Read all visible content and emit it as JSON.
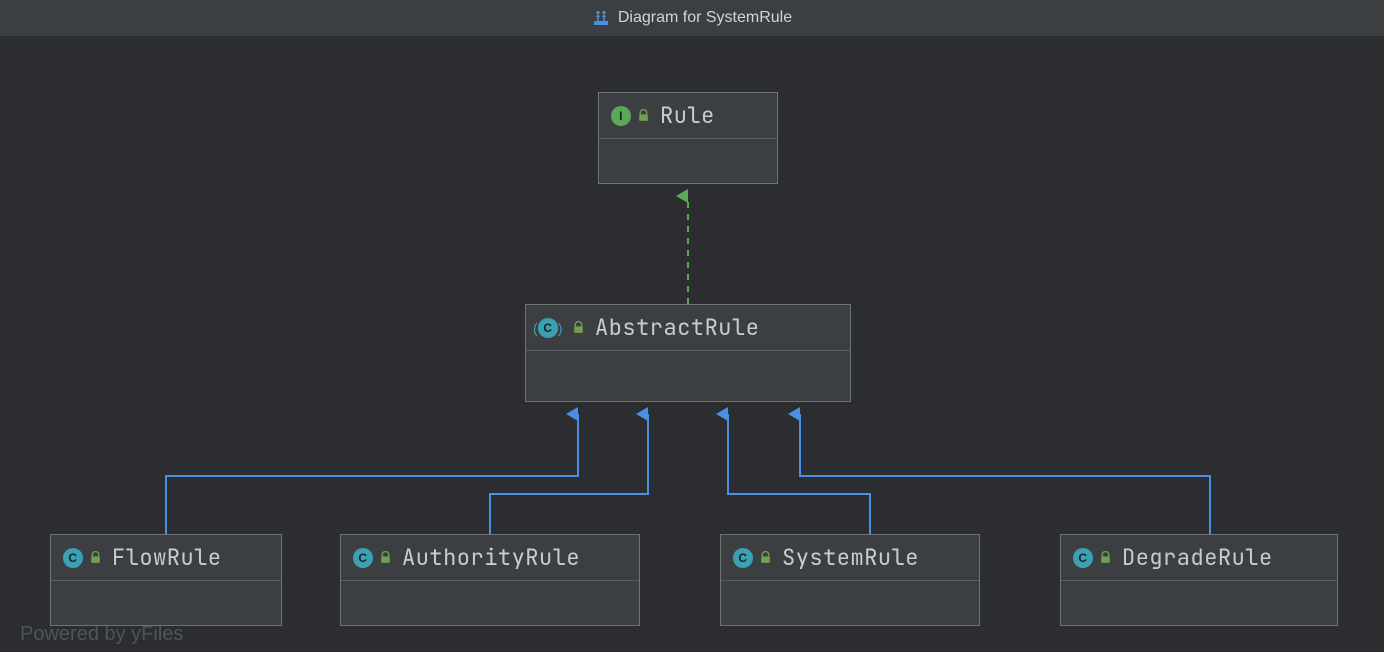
{
  "header": {
    "title": "Diagram for SystemRule"
  },
  "nodes": {
    "rule": {
      "name": "Rule",
      "kind": "interface",
      "badge_letter": "I"
    },
    "abstractRule": {
      "name": "AbstractRule",
      "kind": "abstract-class",
      "badge_letter": "C"
    },
    "flowRule": {
      "name": "FlowRule",
      "kind": "class",
      "badge_letter": "C"
    },
    "authorityRule": {
      "name": "AuthorityRule",
      "kind": "class",
      "badge_letter": "C"
    },
    "systemRule": {
      "name": "SystemRule",
      "kind": "class",
      "badge_letter": "C"
    },
    "degradeRule": {
      "name": "DegradeRule",
      "kind": "class",
      "badge_letter": "C"
    }
  },
  "edges": [
    {
      "from": "abstractRule",
      "to": "rule",
      "style": "implements"
    },
    {
      "from": "flowRule",
      "to": "abstractRule",
      "style": "extends"
    },
    {
      "from": "authorityRule",
      "to": "abstractRule",
      "style": "extends"
    },
    {
      "from": "systemRule",
      "to": "abstractRule",
      "style": "extends"
    },
    {
      "from": "degradeRule",
      "to": "abstractRule",
      "style": "extends"
    }
  ],
  "colors": {
    "implements_edge": "#5aa85a",
    "extends_edge": "#4a90e2"
  },
  "watermark": "Powered by yFiles"
}
